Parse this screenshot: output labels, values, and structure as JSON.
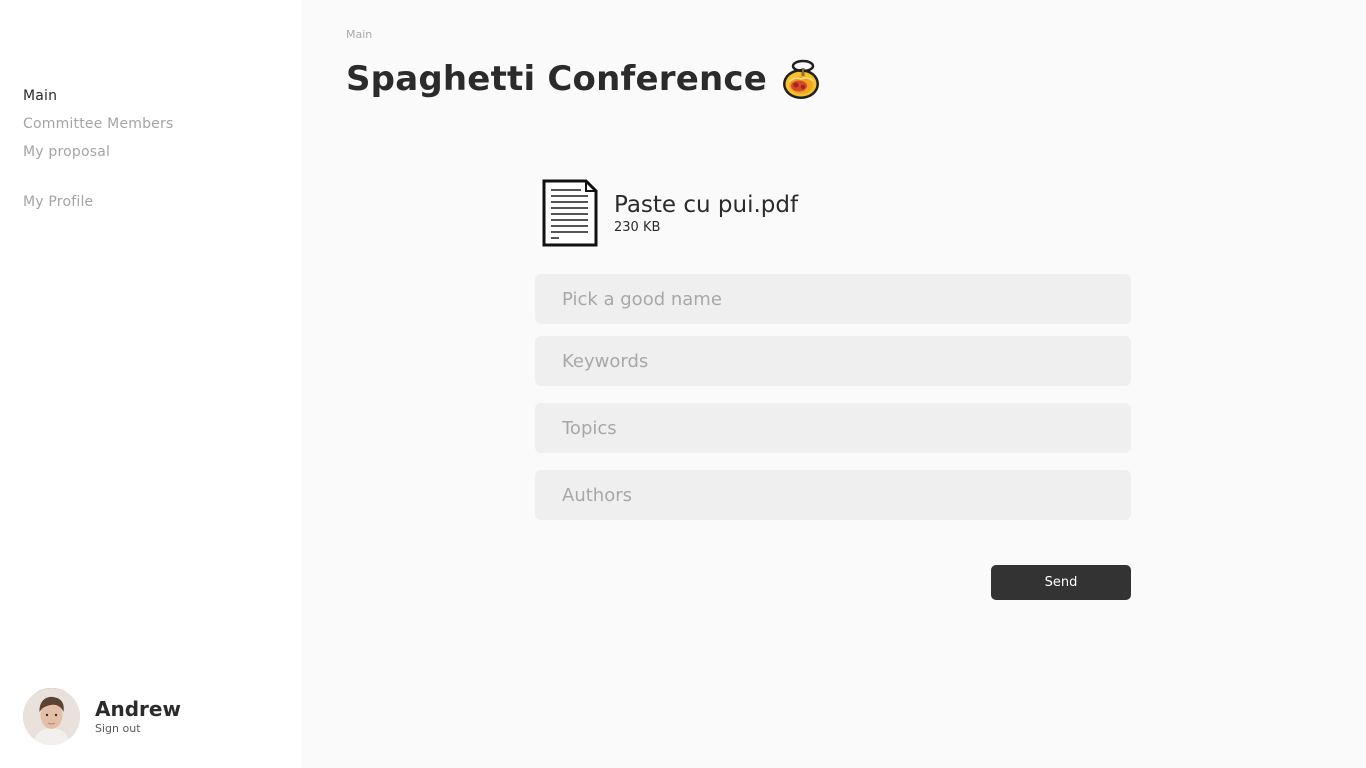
{
  "sidebar": {
    "nav": [
      {
        "label": "Main"
      },
      {
        "label": "Committee Members"
      },
      {
        "label": "My proposal"
      },
      {
        "label": "My Profile"
      }
    ],
    "user": {
      "name": "Andrew",
      "signout_label": "Sign out"
    }
  },
  "main": {
    "breadcrumb": "Main",
    "title": "Spaghetti Conference",
    "title_icon": "spaghetti-bowl-icon",
    "file": {
      "name": "Paste cu pui.pdf",
      "size": "230 KB",
      "icon": "document-icon"
    },
    "form": {
      "name_placeholder": "Pick a good name",
      "keywords_placeholder": "Keywords",
      "topics_placeholder": "Topics",
      "authors_placeholder": "Authors",
      "name_value": "",
      "keywords_value": "",
      "topics_value": "",
      "authors_value": ""
    },
    "send_label": "Send"
  },
  "colors": {
    "sidebar_bg": "#ffffff",
    "main_bg": "#fafafa",
    "field_bg": "#efefef",
    "button_bg": "#333333",
    "muted_text": "#a4a4a4"
  }
}
